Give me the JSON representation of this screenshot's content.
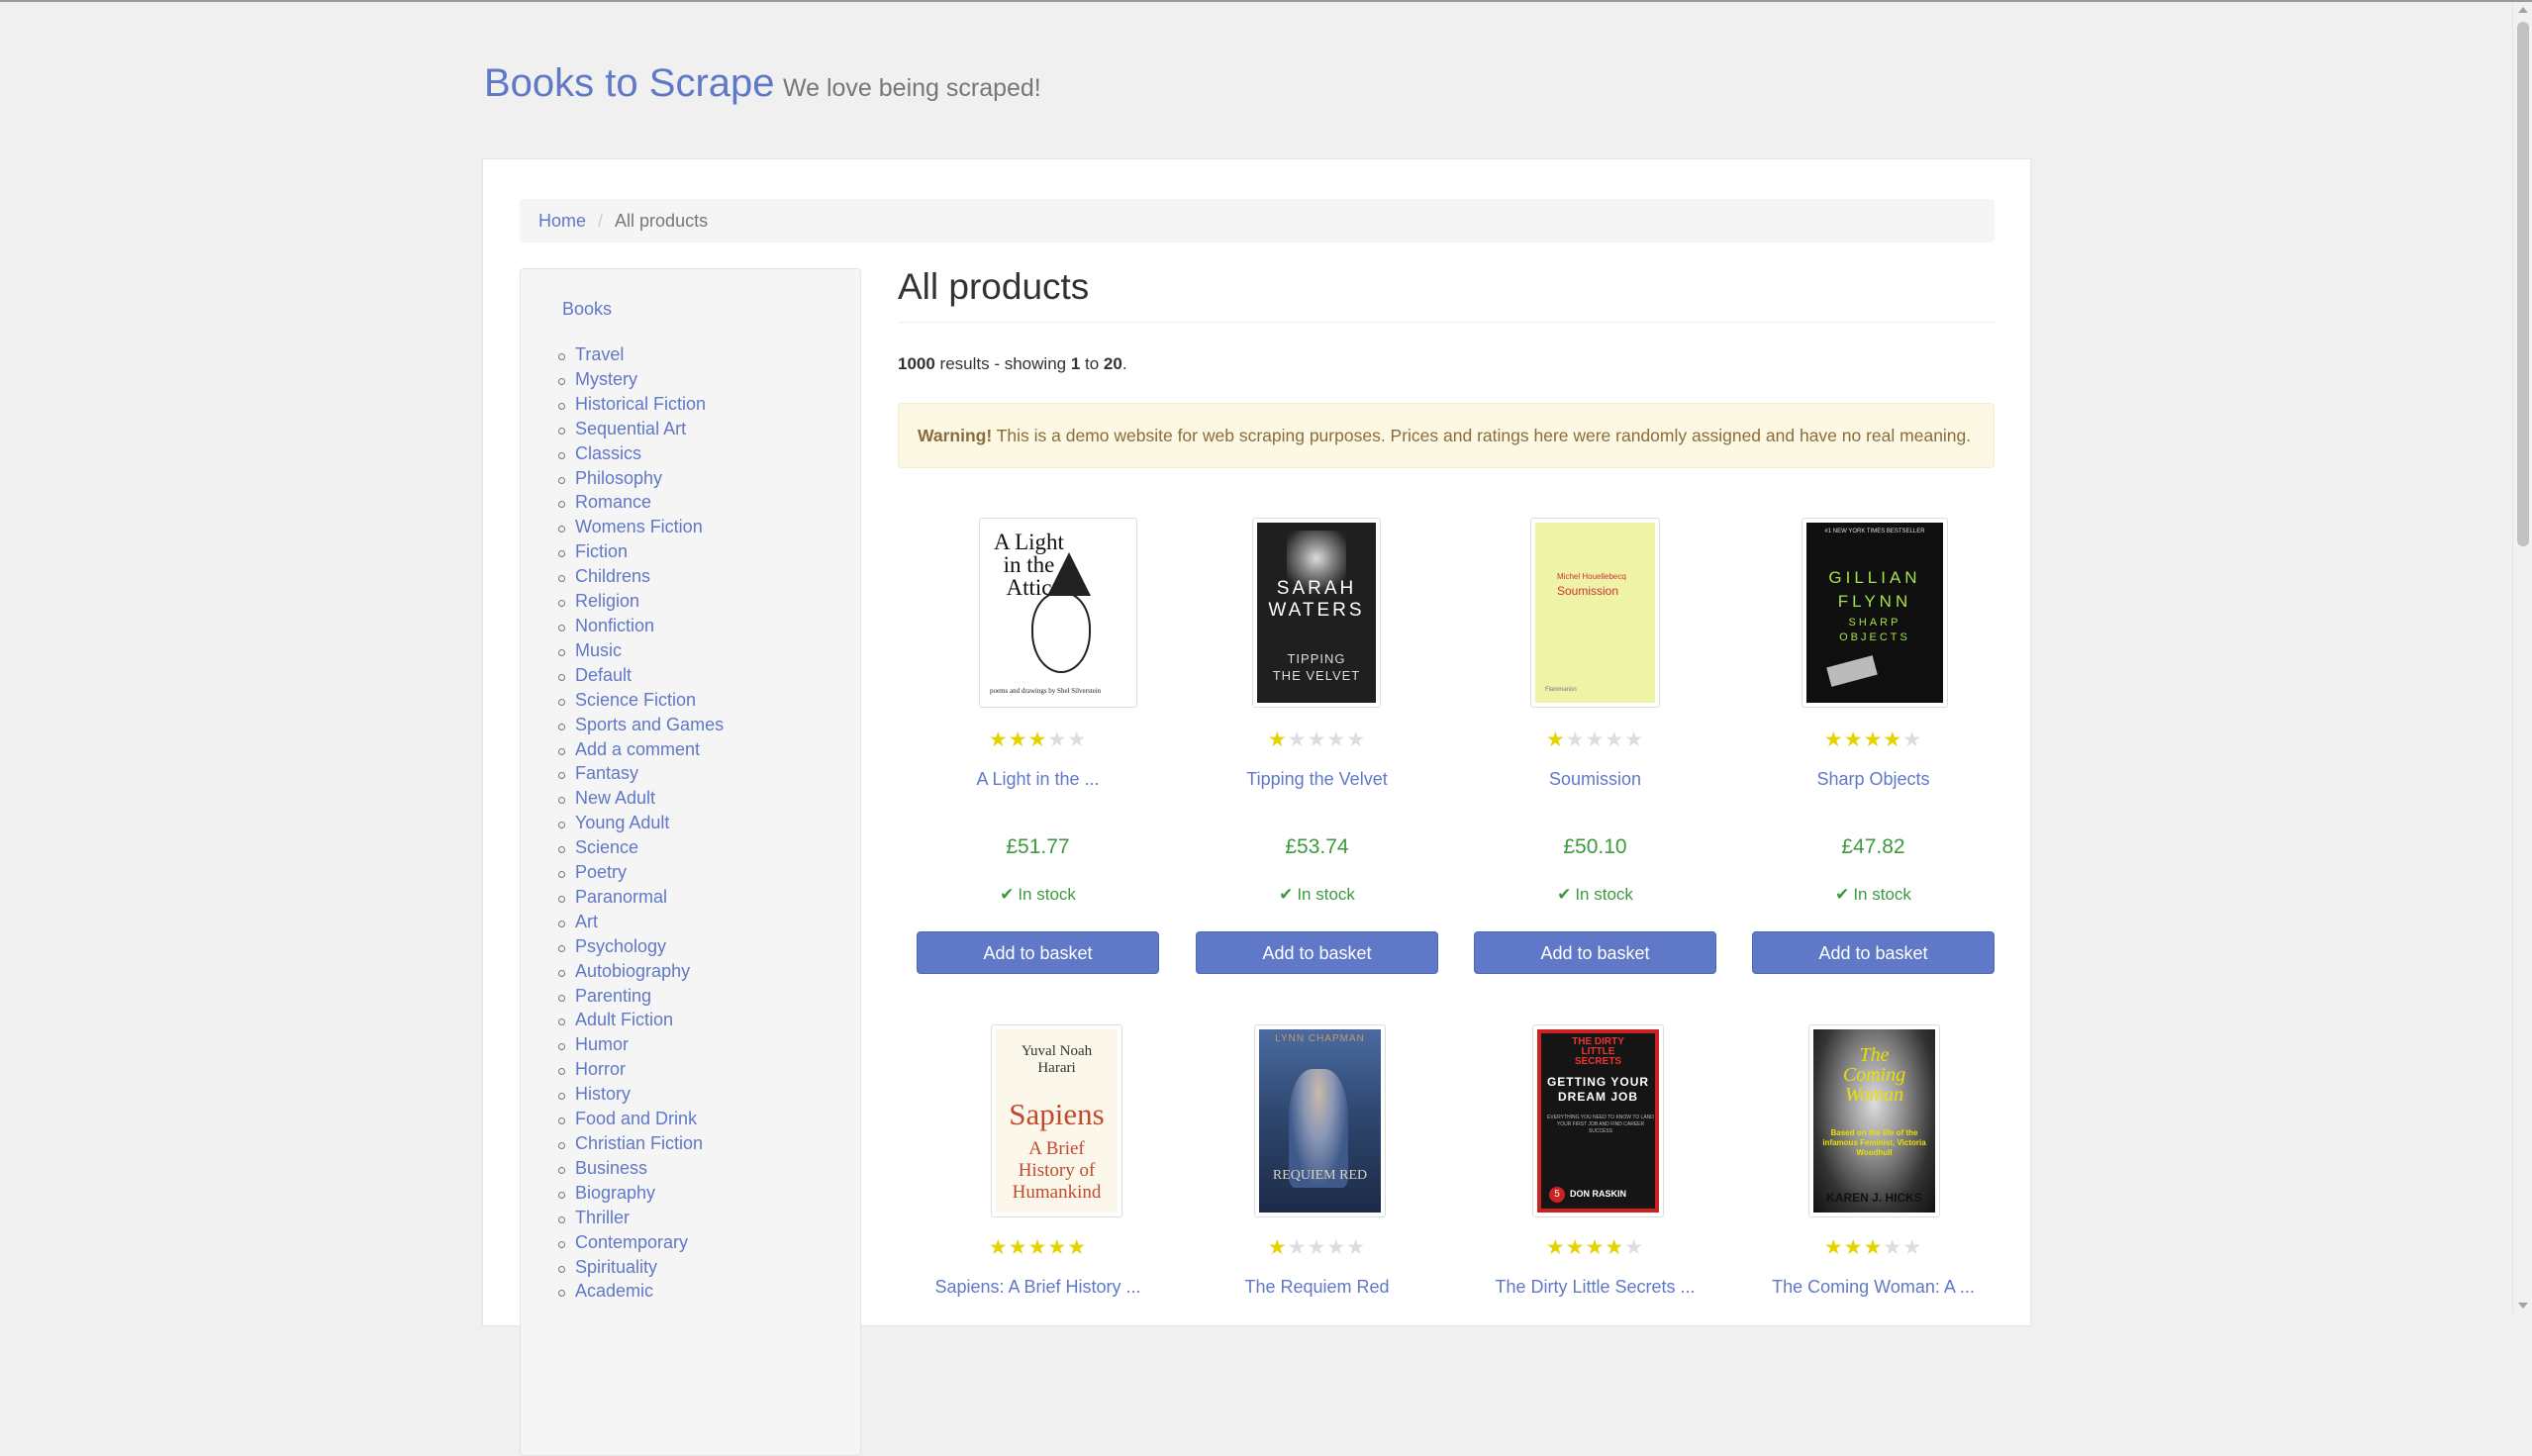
{
  "header": {
    "brand": "Books to Scrape",
    "tagline": "We love being scraped!"
  },
  "breadcrumb": {
    "home": "Home",
    "separator": "/",
    "current": "All products"
  },
  "sidebar": {
    "root": "Books",
    "categories": [
      "Travel",
      "Mystery",
      "Historical Fiction",
      "Sequential Art",
      "Classics",
      "Philosophy",
      "Romance",
      "Womens Fiction",
      "Fiction",
      "Childrens",
      "Religion",
      "Nonfiction",
      "Music",
      "Default",
      "Science Fiction",
      "Sports and Games",
      "Add a comment",
      "Fantasy",
      "New Adult",
      "Young Adult",
      "Science",
      "Poetry",
      "Paranormal",
      "Art",
      "Psychology",
      "Autobiography",
      "Parenting",
      "Adult Fiction",
      "Humor",
      "Horror",
      "History",
      "Food and Drink",
      "Christian Fiction",
      "Business",
      "Biography",
      "Thriller",
      "Contemporary",
      "Spirituality",
      "Academic"
    ]
  },
  "main": {
    "title": "All products",
    "results": {
      "total": "1000",
      "total_suffix": " results - showing ",
      "from": "1",
      "to_word": " to ",
      "to": "20",
      "end": "."
    },
    "warning": {
      "label": "Warning!",
      "text": " This is a demo website for web scraping purposes. Prices and ratings here were randomly assigned and have no real meaning."
    },
    "stock_label": "In stock",
    "add_label": "Add to basket",
    "products": [
      {
        "title": "A Light in the ...",
        "price": "£51.77",
        "rating": 3
      },
      {
        "title": "Tipping the Velvet",
        "price": "£53.74",
        "rating": 1
      },
      {
        "title": "Soumission",
        "price": "£50.10",
        "rating": 1
      },
      {
        "title": "Sharp Objects",
        "price": "£47.82",
        "rating": 4
      },
      {
        "title": "Sapiens: A Brief History ...",
        "price": "",
        "rating": 5
      },
      {
        "title": "The Requiem Red",
        "price": "",
        "rating": 1
      },
      {
        "title": "The Dirty Little Secrets ...",
        "price": "",
        "rating": 4
      },
      {
        "title": "The Coming Woman: A ...",
        "price": "",
        "rating": 3
      }
    ],
    "covers": {
      "attic": {
        "title_line1": "A Light",
        "title_line2": "in the",
        "title_line3": "Attic",
        "byline": "poems and drawings by Shel Silverstein"
      },
      "velvet": {
        "author1": "SARAH",
        "author2": "WATERS",
        "title1": "TIPPING",
        "title2": "THE VELVET"
      },
      "soumission": {
        "author": "Michel Houellebecq",
        "title": "Soumission",
        "publisher": "Flammarion"
      },
      "sharp": {
        "banner": "#1 NEW YORK TIMES BESTSELLER",
        "author1": "GILLIAN",
        "author2": "FLYNN",
        "title1": "SHARP",
        "title2": "OBJECTS"
      },
      "sapiens": {
        "author1": "Yuval Noah",
        "author2": "Harari",
        "title": "Sapiens",
        "sub1": "A Brief",
        "sub2": "History of",
        "sub3": "Humankind"
      },
      "requiem": {
        "author": "LYNN CHAPMAN",
        "title": "REQUIEM RED"
      },
      "dirty": {
        "top1": "THE DIRTY",
        "top2": "LITTLE",
        "top3": "SECRETS",
        "title1": "GETTING YOUR",
        "title2": "DREAM JOB",
        "blurb": "EVERYTHING YOU NEED TO KNOW TO LAND YOUR FIRST JOB AND FIND CAREER SUCCESS",
        "author": "DON RASKIN",
        "badge": "5"
      },
      "coming": {
        "title1": "The",
        "title2": "Coming",
        "title3": "Woman",
        "blurb": "Based on the life of the infamous Feminist, Victoria Woodhull",
        "author": "KAREN J. HICKS"
      }
    }
  },
  "colors": {
    "link": "#5f78c8",
    "price": "#3c9a3c",
    "star_on": "#e5d300",
    "star_off": "#dddddd",
    "warning_bg": "#fcf8e3"
  }
}
